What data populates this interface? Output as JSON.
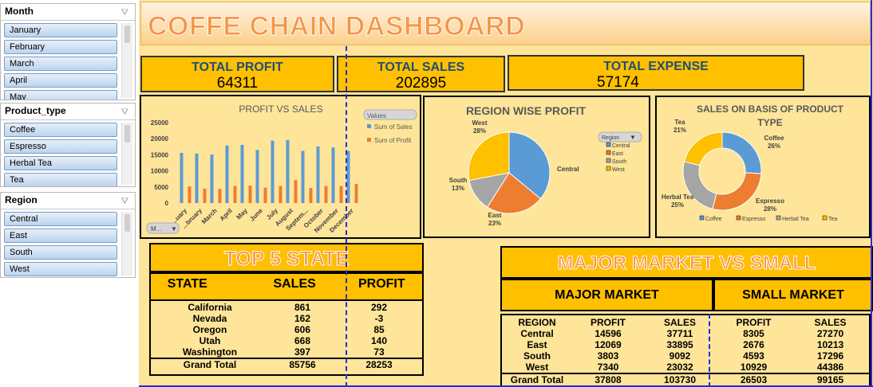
{
  "slicers": {
    "month": {
      "title": "Month",
      "items": [
        "January",
        "February",
        "March",
        "April",
        "May"
      ]
    },
    "product_type": {
      "title": "Product_type",
      "items": [
        "Coffee",
        "Espresso",
        "Herbal Tea",
        "Tea"
      ]
    },
    "region": {
      "title": "Region",
      "items": [
        "Central",
        "East",
        "South",
        "West"
      ]
    }
  },
  "header": {
    "title": "COFFE CHAIN DASHBOARD"
  },
  "kpis": {
    "profit": {
      "label": "TOTAL PROFIT",
      "value": "64311"
    },
    "sales": {
      "label": "TOTAL SALES",
      "value": "202895"
    },
    "expense": {
      "label": "TOTAL EXPENSE",
      "value": "57174"
    }
  },
  "colors": {
    "blue": "#5b9bd5",
    "orange": "#ed7d31",
    "gray": "#a5a5a5",
    "gold": "#ffc000",
    "accent": "#f79645"
  },
  "chart_data": [
    {
      "type": "bar",
      "title": "PROFIT VS SALES",
      "legend_title": "Values",
      "field_button": "M...",
      "categories": [
        "January",
        "February",
        "March",
        "April",
        "May",
        "June",
        "July",
        "August",
        "September",
        "October",
        "November",
        "December"
      ],
      "tick_labels": [
        "...uary",
        "...bruary",
        "March",
        "April",
        "May",
        "June",
        "July",
        "August",
        "Septem...",
        "October",
        "November",
        "December"
      ],
      "series": [
        {
          "name": "Sum of Sales",
          "values": [
            15600,
            15400,
            15100,
            17900,
            18100,
            16500,
            19400,
            19600,
            16200,
            17600,
            17300,
            16200
          ]
        },
        {
          "name": "Sum of Profit",
          "values": [
            5200,
            4500,
            4400,
            5300,
            5400,
            4800,
            5300,
            7100,
            4700,
            5300,
            5300,
            5900
          ]
        }
      ],
      "y_ticks": [
        0,
        5000,
        10000,
        15000,
        20000,
        25000
      ],
      "ylim": [
        0,
        25000
      ],
      "legend": "top-right"
    },
    {
      "type": "pie",
      "title": "REGION WISE PROFIT",
      "legend_title": "Region",
      "labels": [
        "Central",
        "East",
        "South",
        "West"
      ],
      "values": [
        36,
        23,
        13,
        28
      ],
      "value_labels": [
        "",
        "23%",
        "13%",
        "28%"
      ],
      "colors": [
        "#5b9bd5",
        "#ed7d31",
        "#a5a5a5",
        "#ffc000"
      ],
      "legend": "right"
    },
    {
      "type": "pie",
      "title": "SALES ON BASIS OF PRODUCT TYPE",
      "labels": [
        "Coffee",
        "Espresso",
        "Herbal Tea",
        "Tea"
      ],
      "values": [
        26,
        28,
        25,
        21
      ],
      "value_labels": [
        "26%",
        "28%",
        "25%",
        "21%"
      ],
      "colors": [
        "#5b9bd5",
        "#ed7d31",
        "#a5a5a5",
        "#ffc000"
      ],
      "legend": "bottom"
    }
  ],
  "top5": {
    "title": "TOP 5 STATE",
    "headers": [
      "STATE",
      "SALES",
      "PROFIT"
    ],
    "rows": [
      [
        "California",
        "861",
        "292"
      ],
      [
        "Nevada",
        "162",
        "-3"
      ],
      [
        "Oregon",
        "606",
        "85"
      ],
      [
        "Utah",
        "668",
        "140"
      ],
      [
        "Washington",
        "397",
        "73"
      ]
    ],
    "total": [
      "Grand Total",
      "85756",
      "28253"
    ]
  },
  "market": {
    "title": "MAJOR MARKET VS SMALL",
    "major_label": "MAJOR MARKET",
    "small_label": "SMALL MARKET",
    "headers": [
      "REGION",
      "PROFIT",
      "SALES",
      "PROFIT",
      "SALES"
    ],
    "rows": [
      [
        "Central",
        "14596",
        "37711",
        "8305",
        "27270"
      ],
      [
        "East",
        "12069",
        "33895",
        "2676",
        "10213"
      ],
      [
        "South",
        "3803",
        "9092",
        "4593",
        "17296"
      ],
      [
        "West",
        "7340",
        "23032",
        "10929",
        "44386"
      ]
    ],
    "total": [
      "Grand Total",
      "37808",
      "103730",
      "26503",
      "99165"
    ]
  }
}
